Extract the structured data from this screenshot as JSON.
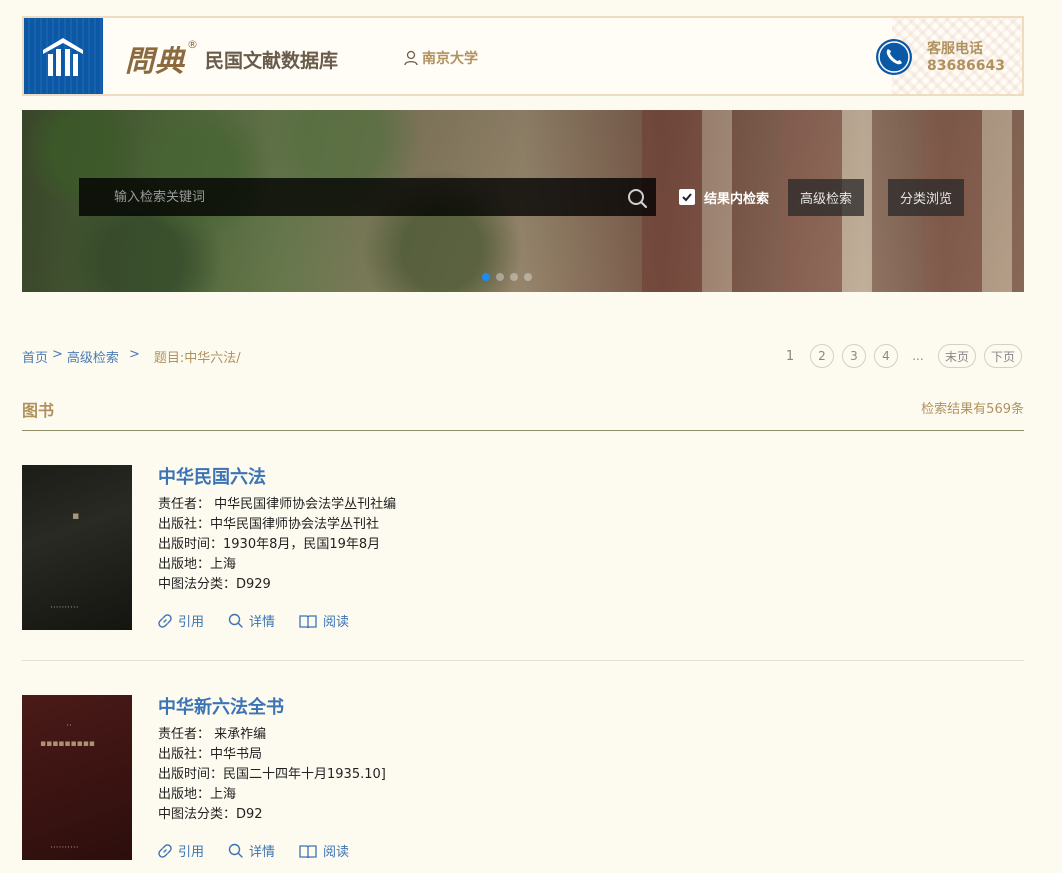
{
  "header": {
    "brand_callig": "問典",
    "brand_reg": "®",
    "brand_name": "民国文献数据库",
    "user_name": "南京大学",
    "phone_label": "客服电话",
    "phone_number": "83686643"
  },
  "search": {
    "placeholder": "输入检索关键词",
    "filter_label": "结果内检索",
    "filter_checked": true,
    "advanced_label": "高级检索",
    "browse_label": "分类浏览"
  },
  "breadcrumb": {
    "home": "首页",
    "sep": ">",
    "advanced": "高级检索",
    "sep2": ">",
    "current": "题目:中华六法/"
  },
  "pagination": {
    "pages": [
      "1",
      "2",
      "3",
      "4"
    ],
    "current": "1",
    "ellipsis": "...",
    "last_label": "末页",
    "next_label": "下页"
  },
  "section": {
    "title": "图书",
    "count_text": "检索结果有569条"
  },
  "books": [
    {
      "title": "中华民国六法",
      "author": "责任者： 中华民国律师协会法学丛刊社编",
      "publisher": "出版社：中华民国律师协会法学丛刊社",
      "date": "出版时间：1930年8月，民国19年8月",
      "place": "出版地：上海",
      "classification": "中图法分类：D929"
    },
    {
      "title": "中华新六法全书",
      "author": "责任者： 来承祚编",
      "publisher": "出版社：中华书局",
      "date": "出版时间：民国二十四年十月1935.10]",
      "place": "出版地：上海",
      "classification": "中图法分类：D92"
    }
  ],
  "actions": {
    "cite": "引用",
    "detail": "详情",
    "read": "阅读"
  },
  "colors": {
    "accent_gold": "#b1925f",
    "link_blue": "#3b73b4",
    "logo_blue": "#0b58a6",
    "page_bg": "#fdfbf0"
  }
}
